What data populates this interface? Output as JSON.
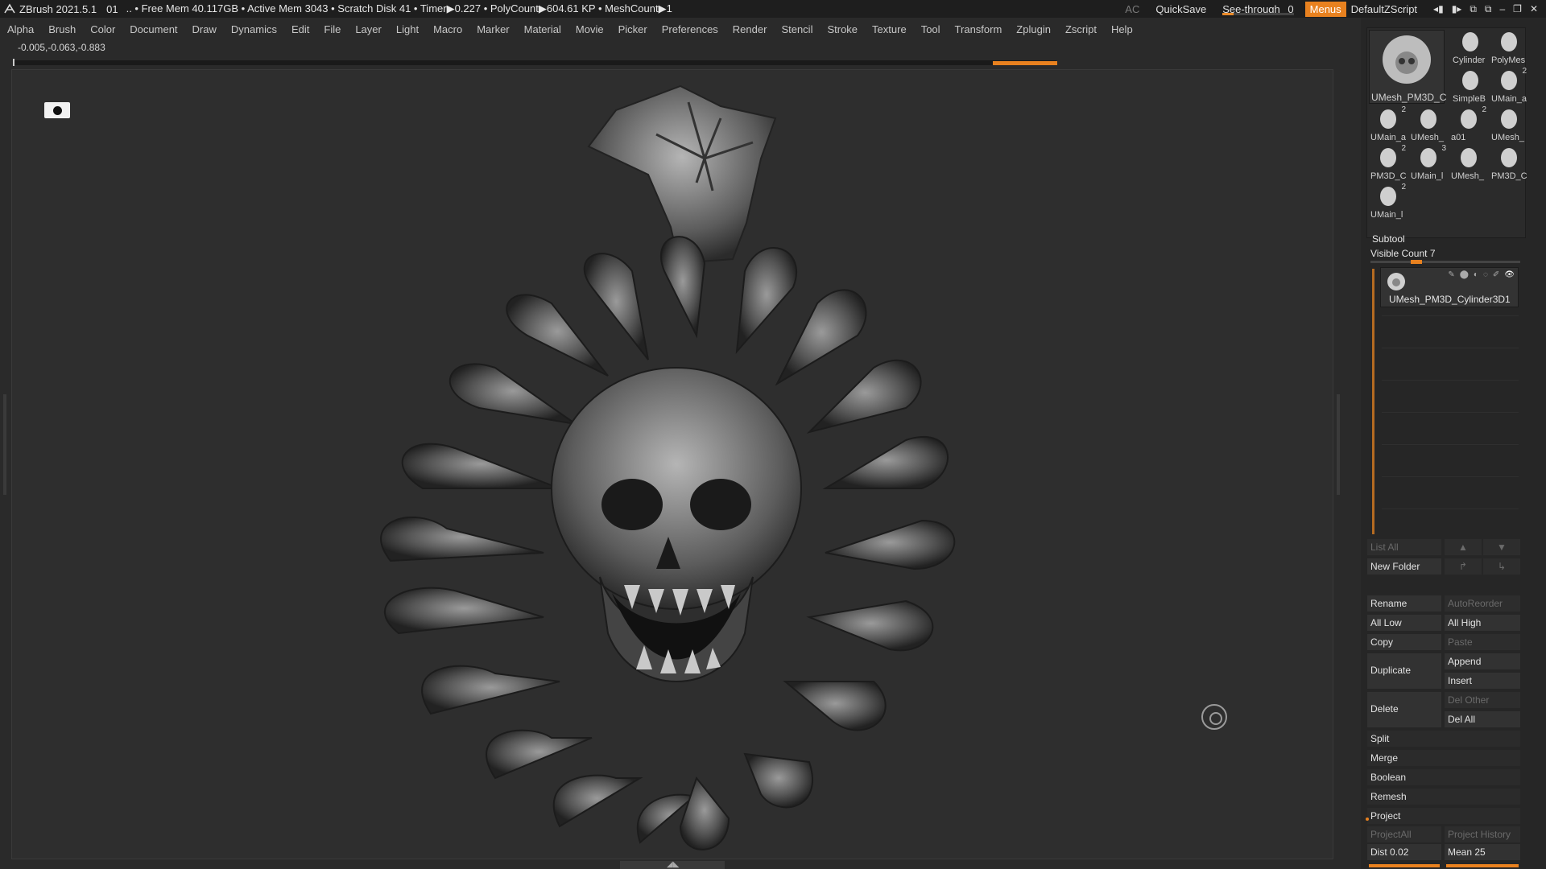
{
  "titlebar": {
    "app": "ZBrush 2021.5.1",
    "doc": "01",
    "stats": ".. • Free Mem 40.117GB • Active Mem 3043 • Scratch Disk 41 •  Timer▶0.227 • PolyCount▶604.61 KP • MeshCount▶1",
    "ac": "AC",
    "quicksave": "QuickSave",
    "seethrough_label": "See-through",
    "seethrough_value": "0",
    "seethrough_level": 0,
    "menus": "Menus",
    "script": "DefaultZScript"
  },
  "menu": [
    "Alpha",
    "Brush",
    "Color",
    "Document",
    "Draw",
    "Dynamics",
    "Edit",
    "File",
    "Layer",
    "Light",
    "Macro",
    "Marker",
    "Material",
    "Movie",
    "Picker",
    "Preferences",
    "Render",
    "Stencil",
    "Stroke",
    "Texture",
    "Tool",
    "Transform",
    "Zplugin",
    "Zscript",
    "Help"
  ],
  "coords": "-0.005,-0.063,-0.883",
  "tools": {
    "big": {
      "label": "UMesh_PM3D_C"
    },
    "items": [
      {
        "label": "Cylinder",
        "count": ""
      },
      {
        "label": "PolyMes",
        "count": ""
      },
      {
        "label": "SimpleB",
        "count": ""
      },
      {
        "label": "UMain_a",
        "count": "2"
      },
      {
        "label": "UMain_a",
        "count": "2"
      },
      {
        "label": "UMesh_",
        "count": ""
      },
      {
        "label": "a01",
        "count": "2"
      },
      {
        "label": "UMesh_",
        "count": ""
      },
      {
        "label": "PM3D_C",
        "count": "2"
      },
      {
        "label": "UMain_l",
        "count": "3"
      },
      {
        "label": "UMesh_",
        "count": ""
      },
      {
        "label": "PM3D_C",
        "count": ""
      },
      {
        "label": "UMain_l",
        "count": "2"
      }
    ]
  },
  "subtool": {
    "header": "Subtool",
    "visible_label": "Visible Count",
    "visible_count": "7",
    "item_name": "UMesh_PM3D_Cylinder3D1",
    "list_all": "List All",
    "new_folder": "New Folder",
    "rename": "Rename",
    "autoreorder": "AutoReorder",
    "all_low": "All Low",
    "all_high": "All High",
    "copy": "Copy",
    "paste": "Paste",
    "duplicate": "Duplicate",
    "append": "Append",
    "insert": "Insert",
    "delete": "Delete",
    "del_other": "Del Other",
    "del_all": "Del All",
    "split": "Split",
    "merge": "Merge",
    "boolean": "Boolean",
    "remesh": "Remesh",
    "project": "Project",
    "projectall": "ProjectAll",
    "project_history": "Project History",
    "dist_label": "Dist",
    "dist_value": "0.02",
    "mean_label": "Mean",
    "mean_value": "25"
  },
  "colors": {
    "accent": "#e8811f",
    "bg": "#2a2a2a",
    "panel": "#262626"
  }
}
